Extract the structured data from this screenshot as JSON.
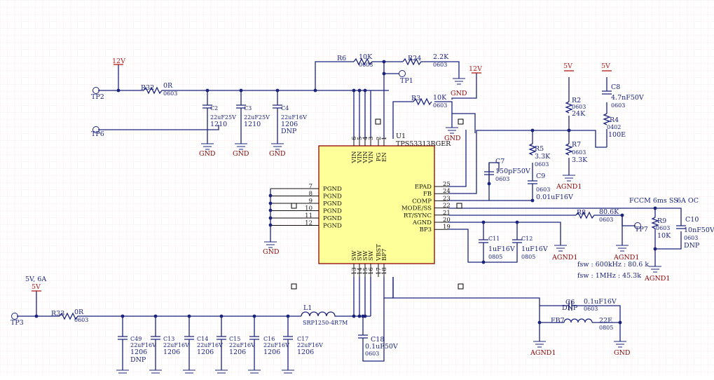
{
  "nets": {
    "v12": "12V",
    "v5": "5V",
    "gnd": "GND",
    "agnd1": "AGND1",
    "out_rating": "5V, 6A"
  },
  "ic": {
    "ref": "U1",
    "part": "TPS53313RGER",
    "top_pins": [
      {
        "num": "6",
        "name": "VIN"
      },
      {
        "num": "5",
        "name": "VIN"
      },
      {
        "num": "4",
        "name": "VIN"
      },
      {
        "num": "3",
        "name": "VIN"
      },
      {
        "num": "2",
        "name": "PG"
      },
      {
        "num": "1",
        "name": "EN"
      }
    ],
    "left_pins": [
      {
        "num": "7",
        "name": "PGND"
      },
      {
        "num": "8",
        "name": "PGND"
      },
      {
        "num": "9",
        "name": "PGND"
      },
      {
        "num": "10",
        "name": "PGND"
      },
      {
        "num": "11",
        "name": "PGND"
      },
      {
        "num": "12",
        "name": "PGND"
      }
    ],
    "right_pins": [
      {
        "num": "25",
        "name": "EPAD"
      },
      {
        "num": "24",
        "name": "FB"
      },
      {
        "num": "23",
        "name": "COMP"
      },
      {
        "num": "22",
        "name": "MODE/SS"
      },
      {
        "num": "21",
        "name": "RT/SYNC"
      },
      {
        "num": "20",
        "name": "AGND"
      },
      {
        "num": "19",
        "name": "BP3"
      }
    ],
    "bottom_pins": [
      {
        "num": "13",
        "name": "SW"
      },
      {
        "num": "14",
        "name": "SW"
      },
      {
        "num": "15",
        "name": "SW"
      },
      {
        "num": "16",
        "name": "SW"
      },
      {
        "num": "17",
        "name": "VBST"
      },
      {
        "num": "18",
        "name": "BP7"
      }
    ]
  },
  "components": {
    "r32": {
      "ref": "R32",
      "value": "0R",
      "pkg": "0603"
    },
    "r6": {
      "ref": "R6",
      "value": "10K",
      "pkg": "0603"
    },
    "r24": {
      "ref": "R24",
      "value": "2.2K",
      "pkg": "0603"
    },
    "r3": {
      "ref": "R3",
      "value": "10K",
      "pkg": "0603"
    },
    "r2": {
      "ref": "R2",
      "value": "0603",
      "val2": "24K"
    },
    "r4": {
      "ref": "R4",
      "value": "0402",
      "val2": "100E"
    },
    "r5": {
      "ref": "R5",
      "value": "3.3K",
      "pkg": "0603"
    },
    "r7": {
      "ref": "R7",
      "value": "0603",
      "val2": "3.3K"
    },
    "r8": {
      "ref": "R8",
      "value": "80.6K",
      "pkg": "0603"
    },
    "r9": {
      "ref": "R9",
      "value": "0603",
      "val2": "10K"
    },
    "r33": {
      "ref": "R33",
      "value": "0R",
      "pkg": "0603"
    },
    "c2": {
      "ref": "C2",
      "value": "22uF25V",
      "pkg": "1210"
    },
    "c3": {
      "ref": "C3",
      "value": "22uF25V",
      "pkg": "1210"
    },
    "c4": {
      "ref": "C4",
      "value": "22uF16V",
      "pkg": "1206",
      "note": "DNP"
    },
    "c7": {
      "ref": "C7",
      "value": "150pF50V",
      "pkg": "0603"
    },
    "c8": {
      "ref": "C8",
      "value": "4.7nF50V",
      "pkg": "0603"
    },
    "c9": {
      "ref": "C9",
      "value": "0603",
      "val2": "0.01uF16V"
    },
    "c10": {
      "ref": "C10",
      "value": "10nF50V",
      "pkg": "0603",
      "note": "DNP"
    },
    "c11": {
      "ref": "C11",
      "value": "1uF16V",
      "pkg": "0805"
    },
    "c12": {
      "ref": "C12",
      "value": "1uF16V",
      "pkg": "0805"
    },
    "c6": {
      "ref": "C6",
      "value": "0.1uF16V",
      "pkg": "0603",
      "note": "DNP"
    },
    "c18": {
      "ref": "C18",
      "value": "0.1uF50V",
      "pkg": "0603"
    },
    "c49": {
      "ref": "C49",
      "value": "22uF16V",
      "pkg": "1206",
      "note": "DNP"
    },
    "c13": {
      "ref": "C13",
      "value": "22uF16V",
      "pkg": "1206"
    },
    "c14": {
      "ref": "C14",
      "value": "22uF16V",
      "pkg": "1206"
    },
    "c15": {
      "ref": "C15",
      "value": "22uF16V",
      "pkg": "1206"
    },
    "c16": {
      "ref": "C16",
      "value": "22uF16V",
      "pkg": "1206"
    },
    "c17": {
      "ref": "C17",
      "value": "22uF16V",
      "pkg": "1206"
    },
    "l1": {
      "ref": "L1",
      "value": "SRP1250-4R7M"
    },
    "fb7": {
      "ref": "FB7",
      "value": "22E",
      "pkg": "0805"
    },
    "tp1": "TP1",
    "tp2": "TP2",
    "tp3": "TP3",
    "tp6": "TP6",
    "tp7": "TP7"
  },
  "notes": {
    "mode": "FCCM 6ms SS",
    "oc": "6A OC",
    "fsw1": "fsw : 600kHz : 80.6 k",
    "fsw2": "fsw : 1MHz : 45.3k"
  },
  "colors": {
    "wire": "#1a237e",
    "ic_fill": "#ffff99",
    "power_net": "#b71c1c",
    "ground": "#8b0000"
  }
}
